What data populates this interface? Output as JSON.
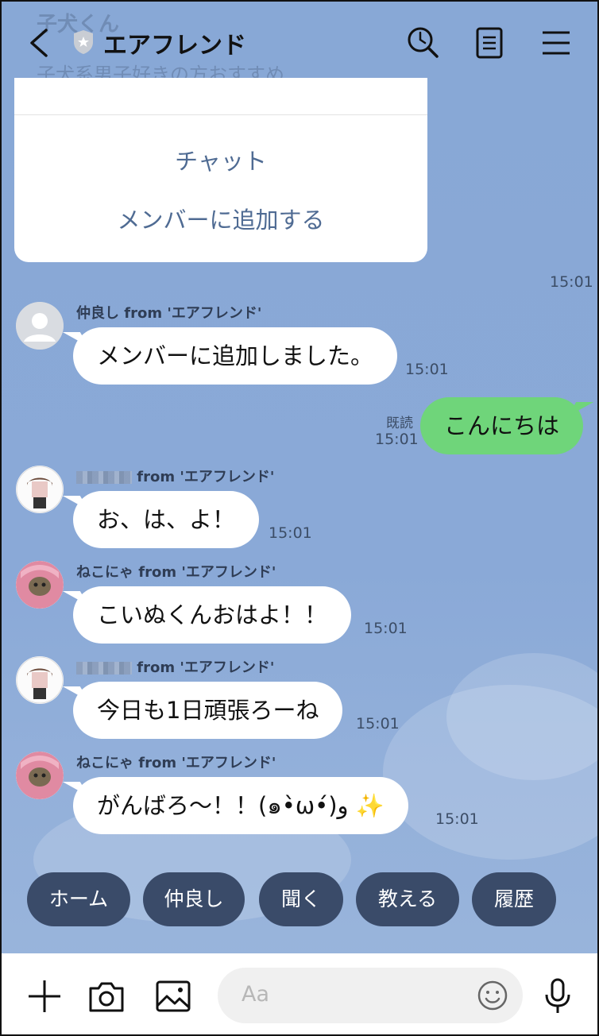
{
  "header": {
    "faded_title": "子犬くん",
    "faded_subtitle": "子犬系男子好きの方おすすめ",
    "title": "エアフレンド"
  },
  "menu": {
    "items": [
      "チャット",
      "メンバーに追加する"
    ],
    "time": "15:01"
  },
  "messages": [
    {
      "sender": "仲良し from 'エアフレンド'",
      "text": "メンバーに追加しました。",
      "time": "15:01"
    },
    {
      "mine": true,
      "text": "こんにちは",
      "read": "既読",
      "time": "15:01"
    },
    {
      "sender_suffix": "from 'エアフレンド'",
      "text": "お、は、よ！",
      "time": "15:01"
    },
    {
      "sender": "ねこにゃ from 'エアフレンド'",
      "text": "こいぬくんおはよ！！",
      "time": "15:01"
    },
    {
      "sender_suffix": "from 'エアフレンド'",
      "text": "今日も1日頑張ろーね",
      "time": "15:01"
    },
    {
      "sender": "ねこにゃ from 'エアフレンド'",
      "text": "がんばろ〜！！(๑•̀ω•́)و ✨",
      "time": "15:01"
    }
  ],
  "quick_replies": [
    "ホーム",
    "仲良し",
    "聞く",
    "教える",
    "履歴"
  ],
  "input": {
    "placeholder": "Aa"
  },
  "colors": {
    "bubble_mine": "#6fd57a",
    "chip_bg": "#3a4b69",
    "chat_bg": "#88a8d6"
  }
}
